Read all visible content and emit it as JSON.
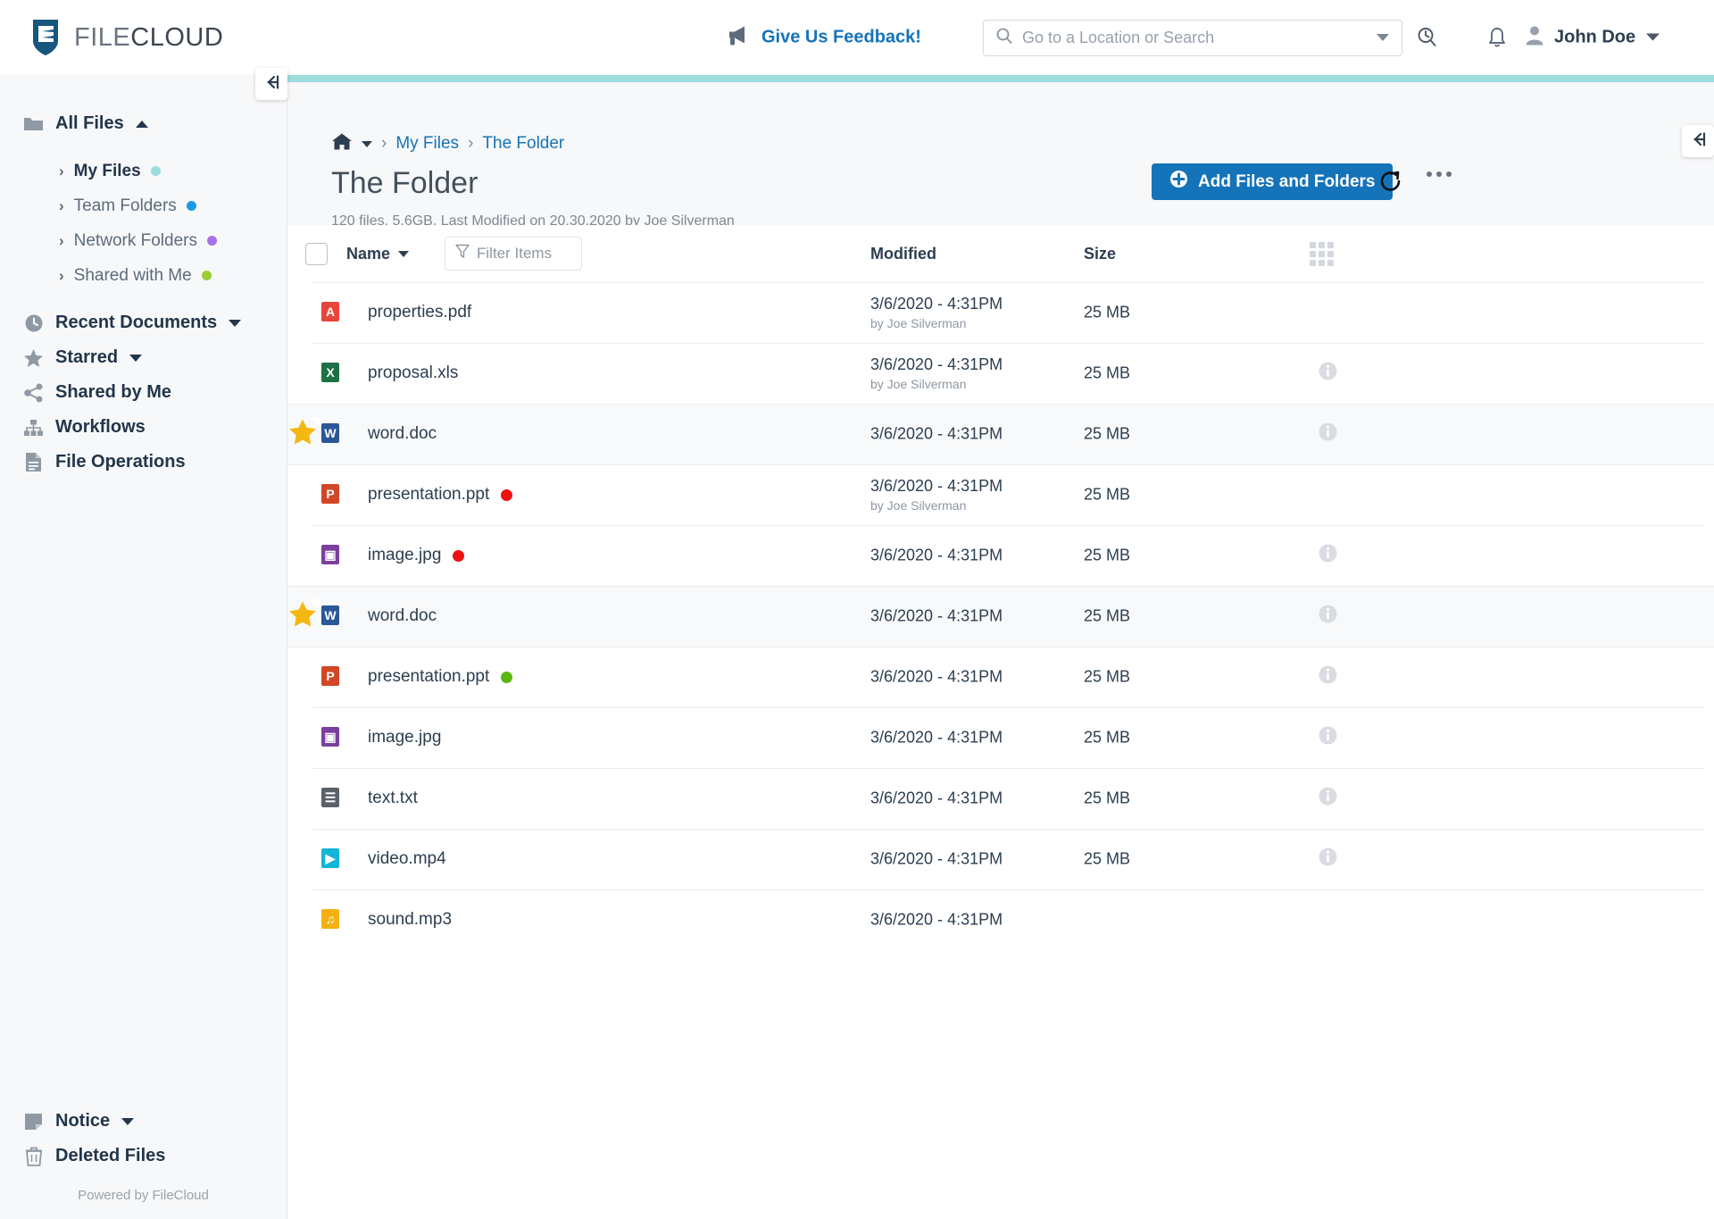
{
  "brand": {
    "name_part1": "FILE",
    "name_part2": "CLOUD"
  },
  "topbar": {
    "feedback_label": "Give Us Feedback!",
    "feedback_icon": "megaphone-icon",
    "search_placeholder": "Go to a Location or Search",
    "search_value": "",
    "search_icon": "search-icon",
    "search_dropdown_icon": "chevron-down-icon",
    "history_icon": "search-history-icon",
    "notifications_icon": "bell-icon",
    "user_icon": "person-icon",
    "user_name": "John Doe",
    "user_dropdown_icon": "chevron-down-icon"
  },
  "sidebar": {
    "collapse_icon": "collapse-left-icon",
    "all_files": {
      "label": "All Files",
      "icon": "folder-icon",
      "caret": "caret-up"
    },
    "sub_items": [
      {
        "label": "My Files",
        "dot": "#9bdbdd",
        "active": true
      },
      {
        "label": "Team Folders",
        "dot": "#1b9ae8",
        "active": false
      },
      {
        "label": "Network Folders",
        "dot": "#a970e8",
        "active": false
      },
      {
        "label": "Shared with Me",
        "dot": "#9acd32",
        "active": false
      }
    ],
    "items": [
      {
        "label": "Recent Documents",
        "icon": "clock-icon",
        "caret": "caret-down"
      },
      {
        "label": "Starred",
        "icon": "star-icon",
        "caret": "caret-down"
      },
      {
        "label": "Shared by Me",
        "icon": "share-icon",
        "caret": ""
      },
      {
        "label": "Workflows",
        "icon": "workflow-icon",
        "caret": ""
      },
      {
        "label": "File Operations",
        "icon": "document-icon",
        "caret": ""
      }
    ],
    "bottom_items": [
      {
        "label": "Notice",
        "icon": "note-icon",
        "caret": "caret-down"
      },
      {
        "label": "Deleted Files",
        "icon": "trash-icon",
        "caret": ""
      }
    ],
    "powered_by": "Powered by FileCloud"
  },
  "main": {
    "right_collapse_icon": "collapse-left-icon",
    "breadcrumb": {
      "home_icon": "home-icon",
      "home_caret_icon": "caret-down-icon",
      "separator": "›",
      "items": [
        "My Files",
        "The Folder"
      ]
    },
    "page_title": "The Folder",
    "page_subtitle": "120 files, 5.6GB, Last Modified on 20.30.2020 by Joe Silverman",
    "add_button_label": "Add Files and Folders",
    "add_button_icon": "plus-circle-icon",
    "add_button_color": "#1573b9",
    "refresh_icon": "refresh-icon",
    "more_icon": "more-horizontal-icon",
    "accent_color": "#9ddbdd"
  },
  "table": {
    "select_all_checkbox": "unchecked",
    "col_name": "Name",
    "name_sort_icon": "caret-down-icon",
    "filter_placeholder": "Filter Items",
    "filter_value": "",
    "filter_icon": "funnel-icon",
    "col_modified": "Modified",
    "col_size": "Size",
    "grid_view_icon": "grid-view-icon",
    "rows": [
      {
        "name": "properties.pdf",
        "ext": "pdf",
        "badge": "A",
        "badge_color": "#e8453c",
        "starred": false,
        "status_dot": "",
        "modified": "3/6/2020 - 4:31PM",
        "modified_by": "by Joe Silverman",
        "size": "25 MB",
        "info": false,
        "shaded": false
      },
      {
        "name": "proposal.xls",
        "ext": "xls",
        "badge": "X",
        "badge_color": "#1e7145",
        "starred": false,
        "status_dot": "",
        "modified": "3/6/2020 - 4:31PM",
        "modified_by": "by Joe Silverman",
        "size": "25 MB",
        "info": true,
        "shaded": false
      },
      {
        "name": "word.doc",
        "ext": "doc",
        "badge": "W",
        "badge_color": "#2b5797",
        "starred": true,
        "status_dot": "",
        "modified": "3/6/2020 - 4:31PM",
        "modified_by": "",
        "size": "25 MB",
        "info": true,
        "shaded": true
      },
      {
        "name": "presentation.ppt",
        "ext": "ppt",
        "badge": "P",
        "badge_color": "#d24726",
        "starred": false,
        "status_dot": "#ee1111",
        "modified": "3/6/2020 - 4:31PM",
        "modified_by": "by Joe Silverman",
        "size": "25 MB",
        "info": false,
        "shaded": false
      },
      {
        "name": "image.jpg",
        "ext": "jpg",
        "badge": "▣",
        "badge_color": "#7b3fa0",
        "starred": false,
        "status_dot": "#ee1111",
        "modified": "3/6/2020 - 4:31PM",
        "modified_by": "",
        "size": "25 MB",
        "info": true,
        "shaded": false
      },
      {
        "name": "word.doc",
        "ext": "doc",
        "badge": "W",
        "badge_color": "#2b5797",
        "starred": true,
        "status_dot": "",
        "modified": "3/6/2020 - 4:31PM",
        "modified_by": "",
        "size": "25 MB",
        "info": true,
        "shaded": true
      },
      {
        "name": "presentation.ppt",
        "ext": "ppt",
        "badge": "P",
        "badge_color": "#d24726",
        "starred": false,
        "status_dot": "#5cb811",
        "modified": "3/6/2020 - 4:31PM",
        "modified_by": "",
        "size": "25 MB",
        "info": true,
        "shaded": false
      },
      {
        "name": "image.jpg",
        "ext": "jpg",
        "badge": "▣",
        "badge_color": "#7b3fa0",
        "starred": false,
        "status_dot": "",
        "modified": "3/6/2020 - 4:31PM",
        "modified_by": "",
        "size": "25 MB",
        "info": true,
        "shaded": false
      },
      {
        "name": "text.txt",
        "ext": "txt",
        "badge": "☰",
        "badge_color": "#5a6169",
        "starred": false,
        "status_dot": "",
        "modified": "3/6/2020 - 4:31PM",
        "modified_by": "",
        "size": "25 MB",
        "info": true,
        "shaded": false
      },
      {
        "name": "video.mp4",
        "ext": "mp4",
        "badge": "▶",
        "badge_color": "#13b5d8",
        "starred": false,
        "status_dot": "",
        "modified": "3/6/2020 - 4:31PM",
        "modified_by": "",
        "size": "25 MB",
        "info": true,
        "shaded": false
      },
      {
        "name": "sound.mp3",
        "ext": "mp3",
        "badge": "♫",
        "badge_color": "#f5b014",
        "starred": false,
        "status_dot": "",
        "modified": "3/6/2020 - 4:31PM",
        "modified_by": "",
        "size": "",
        "info": false,
        "shaded": false
      }
    ]
  }
}
